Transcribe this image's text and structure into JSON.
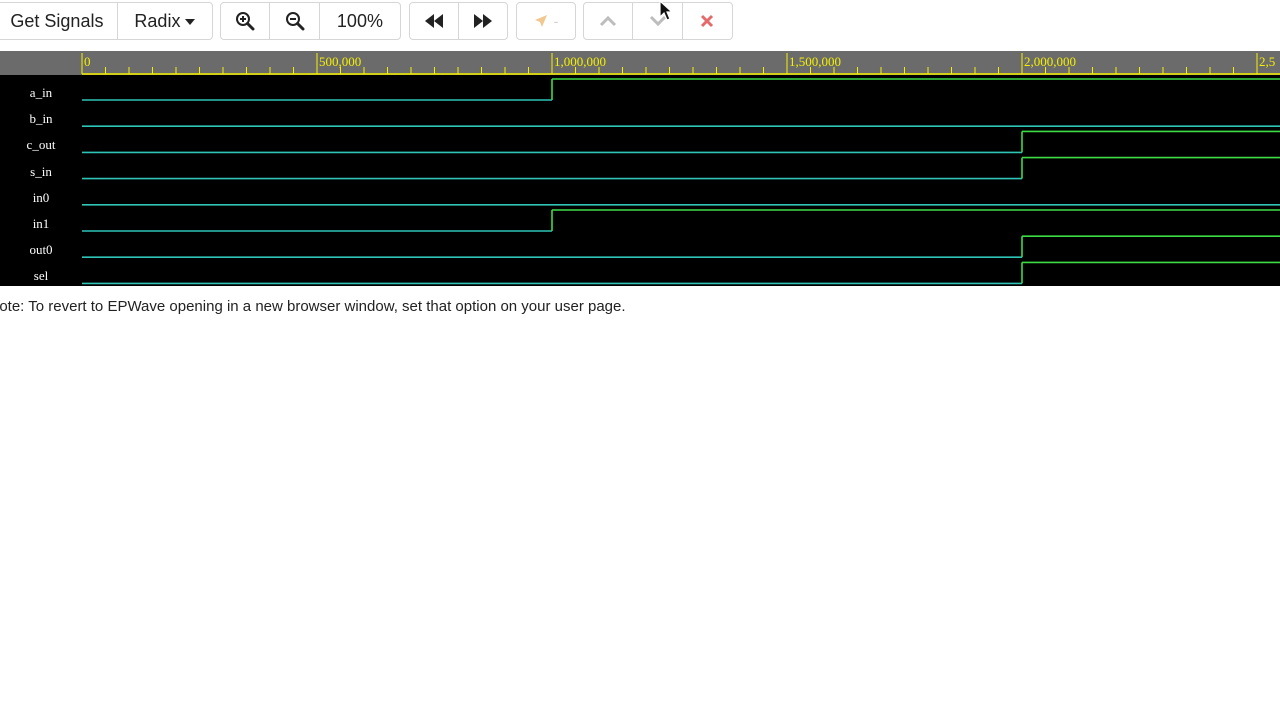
{
  "toolbar": {
    "get_signals": "Get Signals",
    "radix": "Radix",
    "zoom_level": "100%"
  },
  "ruler": {
    "labels": [
      "0",
      "500,000",
      "1,000,000",
      "1,500,000",
      "2,000,000",
      "2,5"
    ]
  },
  "signals": [
    {
      "name": "a_in",
      "transitions": [
        [
          0,
          0
        ],
        [
          1000000,
          1
        ]
      ]
    },
    {
      "name": "b_in",
      "transitions": [
        [
          0,
          0
        ]
      ]
    },
    {
      "name": "c_out",
      "transitions": [
        [
          0,
          0
        ],
        [
          2000000,
          1
        ]
      ]
    },
    {
      "name": "s_in",
      "transitions": [
        [
          0,
          0
        ],
        [
          2000000,
          1
        ]
      ]
    },
    {
      "name": "in0",
      "transitions": [
        [
          0,
          0
        ]
      ]
    },
    {
      "name": "in1",
      "transitions": [
        [
          0,
          0
        ],
        [
          1000000,
          1
        ]
      ]
    },
    {
      "name": "out0",
      "transitions": [
        [
          0,
          0
        ],
        [
          2000000,
          1
        ]
      ]
    },
    {
      "name": "sel",
      "transitions": [
        [
          0,
          0
        ],
        [
          2000000,
          1
        ]
      ]
    }
  ],
  "colors": {
    "low": "#2ec4b6",
    "high": "#3ddc45",
    "ruler_text": "#f5f000",
    "ruler_bg": "#6b6b6b",
    "play_icon": "#f0c890",
    "close_icon": "#e36b6b"
  },
  "note": "lote: To revert to EPWave opening in a new browser window, set that option on your user page."
}
